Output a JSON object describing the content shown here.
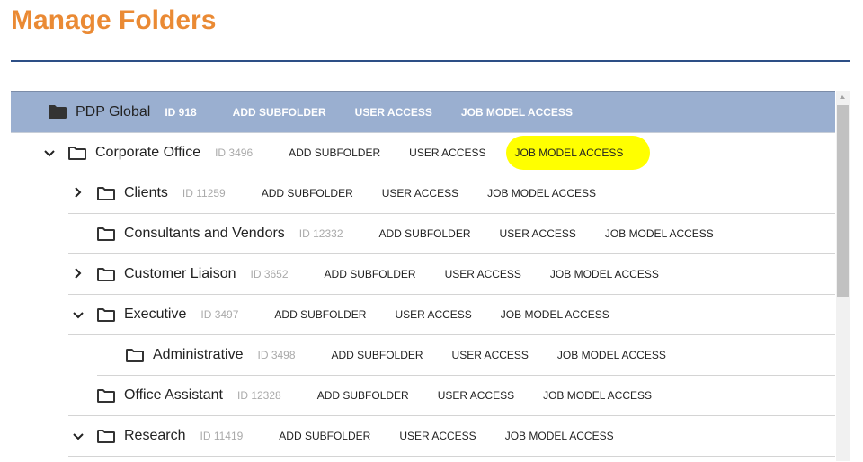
{
  "title": "Manage Folders",
  "actions": {
    "add": "ADD SUBFOLDER",
    "user": "USER ACCESS",
    "job": "JOB MODEL ACCESS"
  },
  "rows": [
    {
      "name": "PDP Global",
      "id": "ID 918",
      "level": 0,
      "chevron": "none",
      "selected": true
    },
    {
      "name": "Corporate Office",
      "id": "ID 3496",
      "level": 1,
      "chevron": "down",
      "highlight": true
    },
    {
      "name": "Clients",
      "id": "ID 11259",
      "level": 2,
      "chevron": "right"
    },
    {
      "name": "Consultants and Vendors",
      "id": "ID 12332",
      "level": 2,
      "chevron": "none"
    },
    {
      "name": "Customer Liaison",
      "id": "ID 3652",
      "level": 2,
      "chevron": "right"
    },
    {
      "name": "Executive",
      "id": "ID 3497",
      "level": 2,
      "chevron": "down"
    },
    {
      "name": "Administrative",
      "id": "ID 3498",
      "level": 3,
      "chevron": "none"
    },
    {
      "name": "Office Assistant",
      "id": "ID 12328",
      "level": 2,
      "chevron": "none"
    },
    {
      "name": "Research",
      "id": "ID 11419",
      "level": 2,
      "chevron": "down"
    }
  ],
  "colors": {
    "title": "#ea8a34",
    "selected_row": "#9aafd0",
    "highlight": "#ffff00"
  }
}
